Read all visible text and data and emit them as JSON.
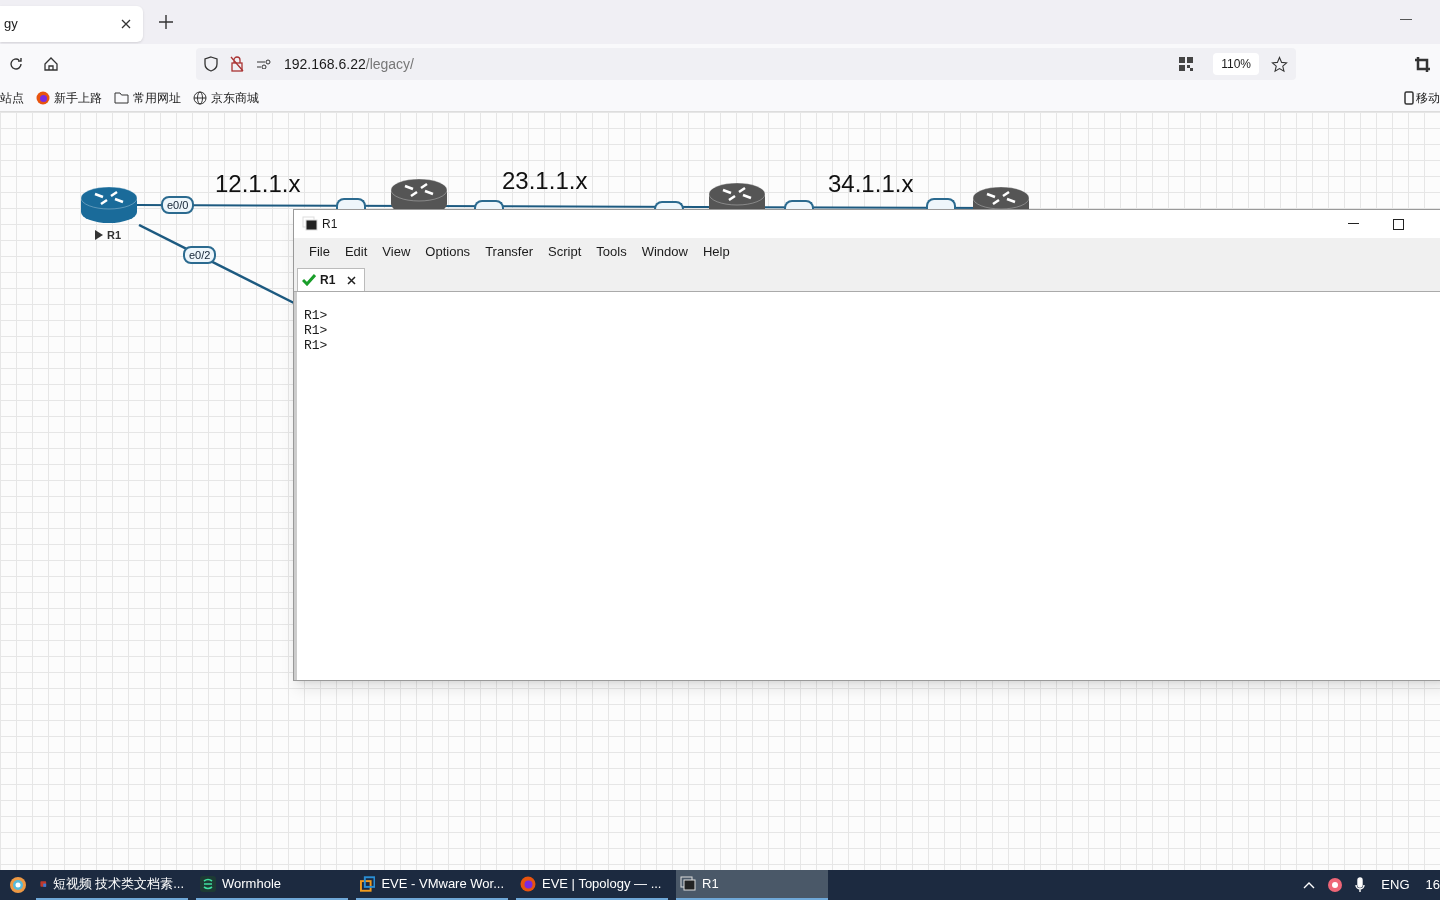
{
  "browser": {
    "tabs": [
      {
        "title": "gy",
        "selected": true
      }
    ],
    "address": {
      "host": "192.168.6.22",
      "path": "/legacy/"
    },
    "zoom": "110%",
    "bookmarks": [
      {
        "kind": "plain",
        "label": "站点"
      },
      {
        "kind": "firefox",
        "label": "新手上路"
      },
      {
        "kind": "folder",
        "label": "常用网址"
      },
      {
        "kind": "globe",
        "label": "京东商城"
      }
    ],
    "bookmarks_right": "移动"
  },
  "topology": {
    "subnets": [
      "12.1.1.x",
      "23.1.1.x",
      "34.1.1.x"
    ],
    "nodes": [
      {
        "label": "R1",
        "running": true
      }
    ],
    "ports": [
      "e0/0",
      "e0/2"
    ]
  },
  "terminal": {
    "title": "R1",
    "menu": [
      "File",
      "Edit",
      "View",
      "Options",
      "Transfer",
      "Script",
      "Tools",
      "Window",
      "Help"
    ],
    "sessions": [
      {
        "label": "R1",
        "connected": true,
        "selected": true
      }
    ],
    "lines": [
      "R1>",
      "R1>",
      "R1>"
    ]
  },
  "taskbar": {
    "items": [
      {
        "kind": "app",
        "label": "短视频 技术类文档素...",
        "selected": false
      },
      {
        "kind": "wormhole",
        "label": "Wormhole",
        "selected": false
      },
      {
        "kind": "vmware",
        "label": "EVE - VMware Wor...",
        "selected": false
      },
      {
        "kind": "firefox",
        "label": "EVE | Topology — ...",
        "selected": false
      },
      {
        "kind": "terminal",
        "label": "R1",
        "selected": true
      }
    ],
    "language": "ENG",
    "clock": "16"
  }
}
